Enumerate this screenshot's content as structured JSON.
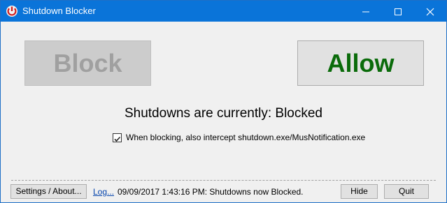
{
  "window": {
    "title": "Shutdown Blocker"
  },
  "controls": {
    "block_label": "Block",
    "allow_label": "Allow",
    "status_text": "Shutdowns are currently: Blocked",
    "intercept_checkbox": {
      "label": "When blocking, also intercept shutdown.exe/MusNotification.exe",
      "checked": true
    }
  },
  "footer": {
    "settings_label": "Settings / About...",
    "log_link": "Log...",
    "log_message": "09/09/2017 1:43:16 PM: Shutdowns now Blocked.",
    "hide_label": "Hide",
    "quit_label": "Quit"
  }
}
